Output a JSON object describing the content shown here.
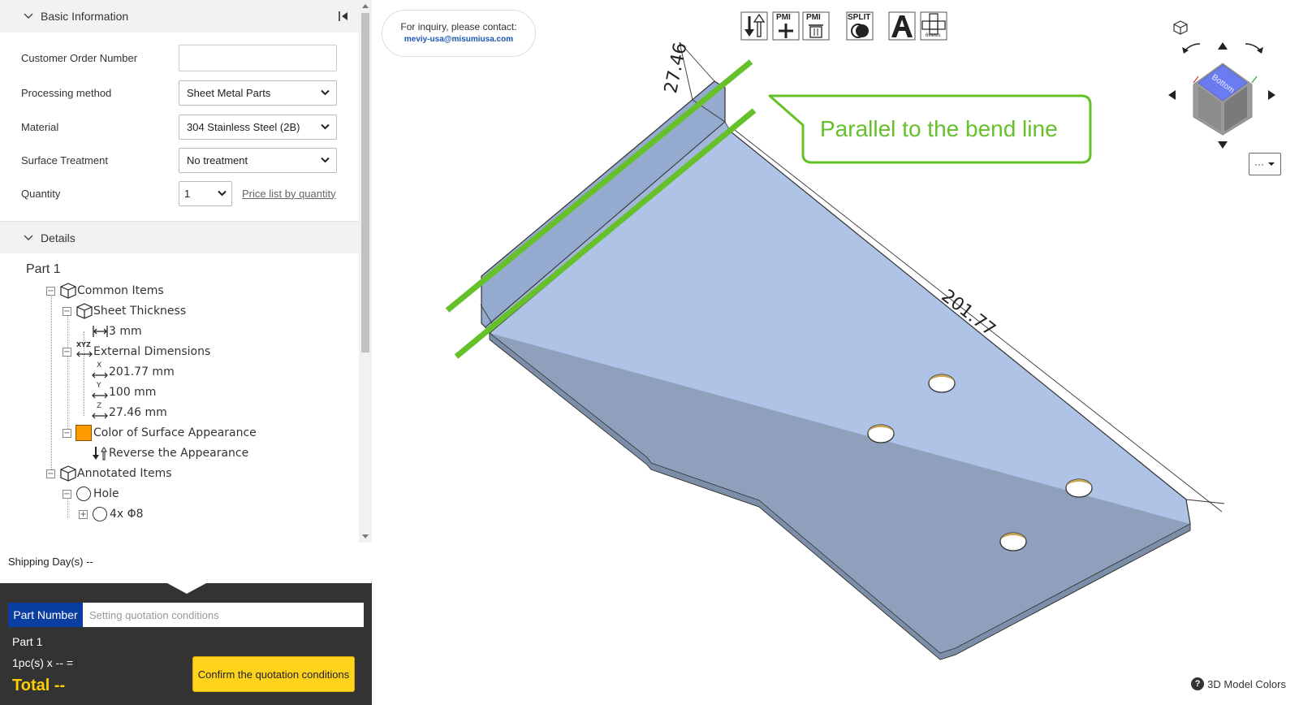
{
  "basic_info": {
    "header": "Basic Information",
    "fields": {
      "customer_order_number": {
        "label": "Customer Order Number",
        "value": ""
      },
      "processing_method": {
        "label": "Processing method",
        "value": "Sheet Metal Parts"
      },
      "material": {
        "label": "Material",
        "value": "304 Stainless Steel (2B)"
      },
      "surface_treatment": {
        "label": "Surface Treatment",
        "value": "No treatment"
      },
      "quantity": {
        "label": "Quantity",
        "value": "1",
        "price_link": "Price list by quantity"
      }
    }
  },
  "details": {
    "header": "Details",
    "part_title": "Part 1",
    "tree": {
      "common_items": "Common Items",
      "sheet_thickness": "Sheet Thickness",
      "thickness_value": "3 mm",
      "external_dimensions": "External Dimensions",
      "dim_x": "201.77 mm",
      "dim_y": "100 mm",
      "dim_z": "27.46 mm",
      "color_of_surface": "Color of Surface Appearance",
      "reverse_appearance": "Reverse the Appearance",
      "annotated_items": "Annotated Items",
      "hole": "Hole",
      "hole_count": "4x Φ8",
      "axis_x": "X",
      "axis_y": "Y",
      "axis_z": "Z",
      "axis_xyz": "XYZ"
    },
    "surface_color": "#ff9900"
  },
  "shipping": {
    "label": "Shipping Day(s) --"
  },
  "quote": {
    "part_number_label": "Part Number",
    "part_number_placeholder": "Setting quotation conditions",
    "part": "Part 1",
    "qty_line": "1pc(s)  x -- =",
    "total": "Total --",
    "confirm_button": "Confirm the quotation conditions"
  },
  "viewer": {
    "inquiry_text": "For inquiry, please contact:",
    "inquiry_email": "meviy-usa@misumiusa.com",
    "callout": "Parallel to the bend line",
    "dim_length": "201.77",
    "dim_height": "27.46",
    "nav_cube_label": "Bottom",
    "more_button": "···",
    "help_text": "3D Model Colors",
    "toolbar": {
      "pmi_add": "PMI",
      "pmi_delete": "PMI",
      "split": "SPLIT",
      "six_views": "6views"
    },
    "colors": {
      "part_face": "#aec3e6",
      "part_flange": "#94aace",
      "highlight": "#65c02a"
    }
  }
}
